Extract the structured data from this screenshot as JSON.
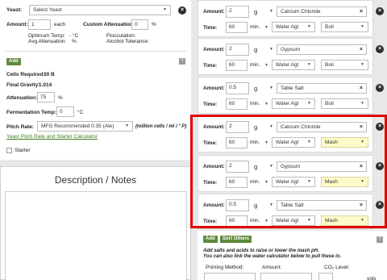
{
  "yeast": {
    "label": "Yeast:",
    "select_value": "Select Yeast",
    "amount_label": "Amount:",
    "amount_value": "1",
    "amount_unit": "each",
    "custom_att_label": "Custom Attenuation:",
    "custom_att_value": "0",
    "custom_att_unit": "%",
    "opt_temp_label": "Optimum Temp:",
    "opt_temp_value": "- °C",
    "avg_att_label": "Avg Attenuation:",
    "avg_att_value": "%",
    "flocculation_label": "Flocculation:",
    "alcohol_tol_label": "Alcohol Tolerance:"
  },
  "calc": {
    "add_button": "Add",
    "help": "?",
    "cells_label": "Cells Required:",
    "cells_value": "30 B",
    "fg_label": "Final Gravity:",
    "fg_value": "1.014",
    "attenuation_label": "Attenuation:",
    "attenuation_value": "75",
    "attenuation_unit": "%",
    "ferm_temp_label": "Fermentation Temp:",
    "ferm_temp_value": "0",
    "ferm_temp_unit": "°C",
    "pitch_label": "Pitch Rate:",
    "pitch_value": "MFG Recommended 0.35 (Ale)",
    "pitch_unit": "(million cells / ml / ° P)",
    "calc_link": "Yeast Pitch Rate and Starter Calculator",
    "starter_label": "Starter"
  },
  "notes": {
    "title": "Description / Notes"
  },
  "water_rows": [
    {
      "amount": "2",
      "unit": "g",
      "agent": "Calcium Chloride",
      "time": "60",
      "time_unit": "min.",
      "type": "Water Agt",
      "use": "Boil"
    },
    {
      "amount": "2",
      "unit": "g",
      "agent": "Gypsum",
      "time": "60",
      "time_unit": "min.",
      "type": "Water Agt",
      "use": "Boil"
    },
    {
      "amount": "0.5",
      "unit": "g",
      "agent": "Table Salt",
      "time": "60",
      "time_unit": "min.",
      "type": "Water Agt",
      "use": "Boil"
    },
    {
      "amount": "2",
      "unit": "g",
      "agent": "Calcium Chloride",
      "time": "60",
      "time_unit": "min.",
      "type": "Water Agt",
      "use": "Mash"
    },
    {
      "amount": "2",
      "unit": "g",
      "agent": "Gypsum",
      "time": "60",
      "time_unit": "min.",
      "type": "Water Agt",
      "use": "Mash"
    },
    {
      "amount": "0.5",
      "unit": "g",
      "agent": "Table Salt",
      "time": "60",
      "time_unit": "min.",
      "type": "Water Agt",
      "use": "Mash"
    }
  ],
  "water_labels": {
    "amount": "Amount:",
    "time": "Time:"
  },
  "footer": {
    "add_button": "Add",
    "sort_button": "Sort Others",
    "help": "?",
    "note1": "Add salts and acids to raise or lower the mash pH.",
    "note2": "You can also link the water calculator below to pull these in.",
    "priming_label": "Priming Method:",
    "amount_label": "Amount:",
    "co2_label": "CO₂ Level:",
    "vols_value": "vols"
  },
  "colors": {
    "highlight": "#e20000",
    "mash_bg": "#fdfbc8",
    "accent_green": "#5f8a3c"
  }
}
